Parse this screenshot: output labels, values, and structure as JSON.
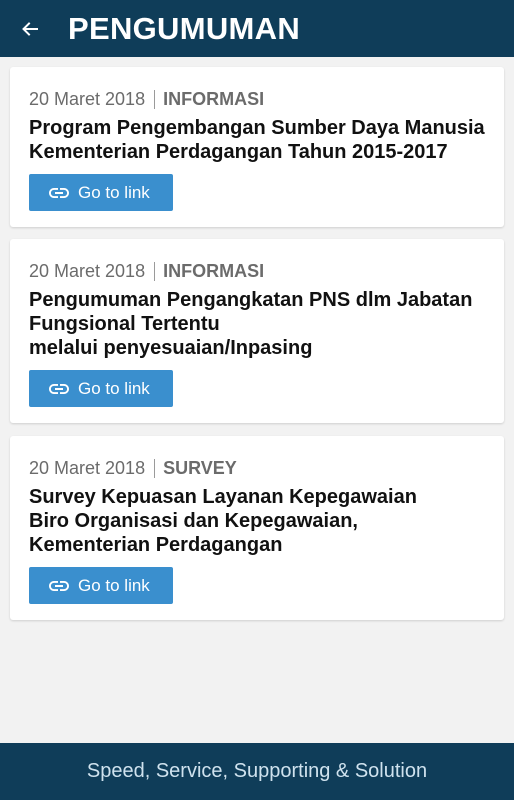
{
  "header": {
    "back_icon": "arrow-left-icon",
    "title": "PENGUMUMAN"
  },
  "announcements": [
    {
      "date": "20 Maret 2018",
      "category": "INFORMASI",
      "title_lines": [
        "Program Pengembangan Sumber Daya Manusia",
        "Kementerian Perdagangan Tahun 2015-2017"
      ],
      "link_label": "Go to link"
    },
    {
      "date": "20 Maret 2018",
      "category": "INFORMASI",
      "title_lines": [
        "Pengumuman Pengangkatan PNS dlm Jabatan",
        "Fungsional Tertentu",
        "melalui penyesuaian/Inpasing"
      ],
      "link_label": "Go to link"
    },
    {
      "date": "20 Maret 2018",
      "category": "SURVEY",
      "title_lines": [
        "Survey Kepuasan Layanan Kepegawaian",
        "Biro Organisasi dan Kepegawaian,",
        "Kementerian Perdagangan"
      ],
      "link_label": "Go to link"
    }
  ],
  "footer": {
    "tagline": "Speed, Service, Supporting & Solution"
  },
  "colors": {
    "primary": "#0f3d59",
    "button": "#3a8fce",
    "background": "#f2f2f2"
  }
}
